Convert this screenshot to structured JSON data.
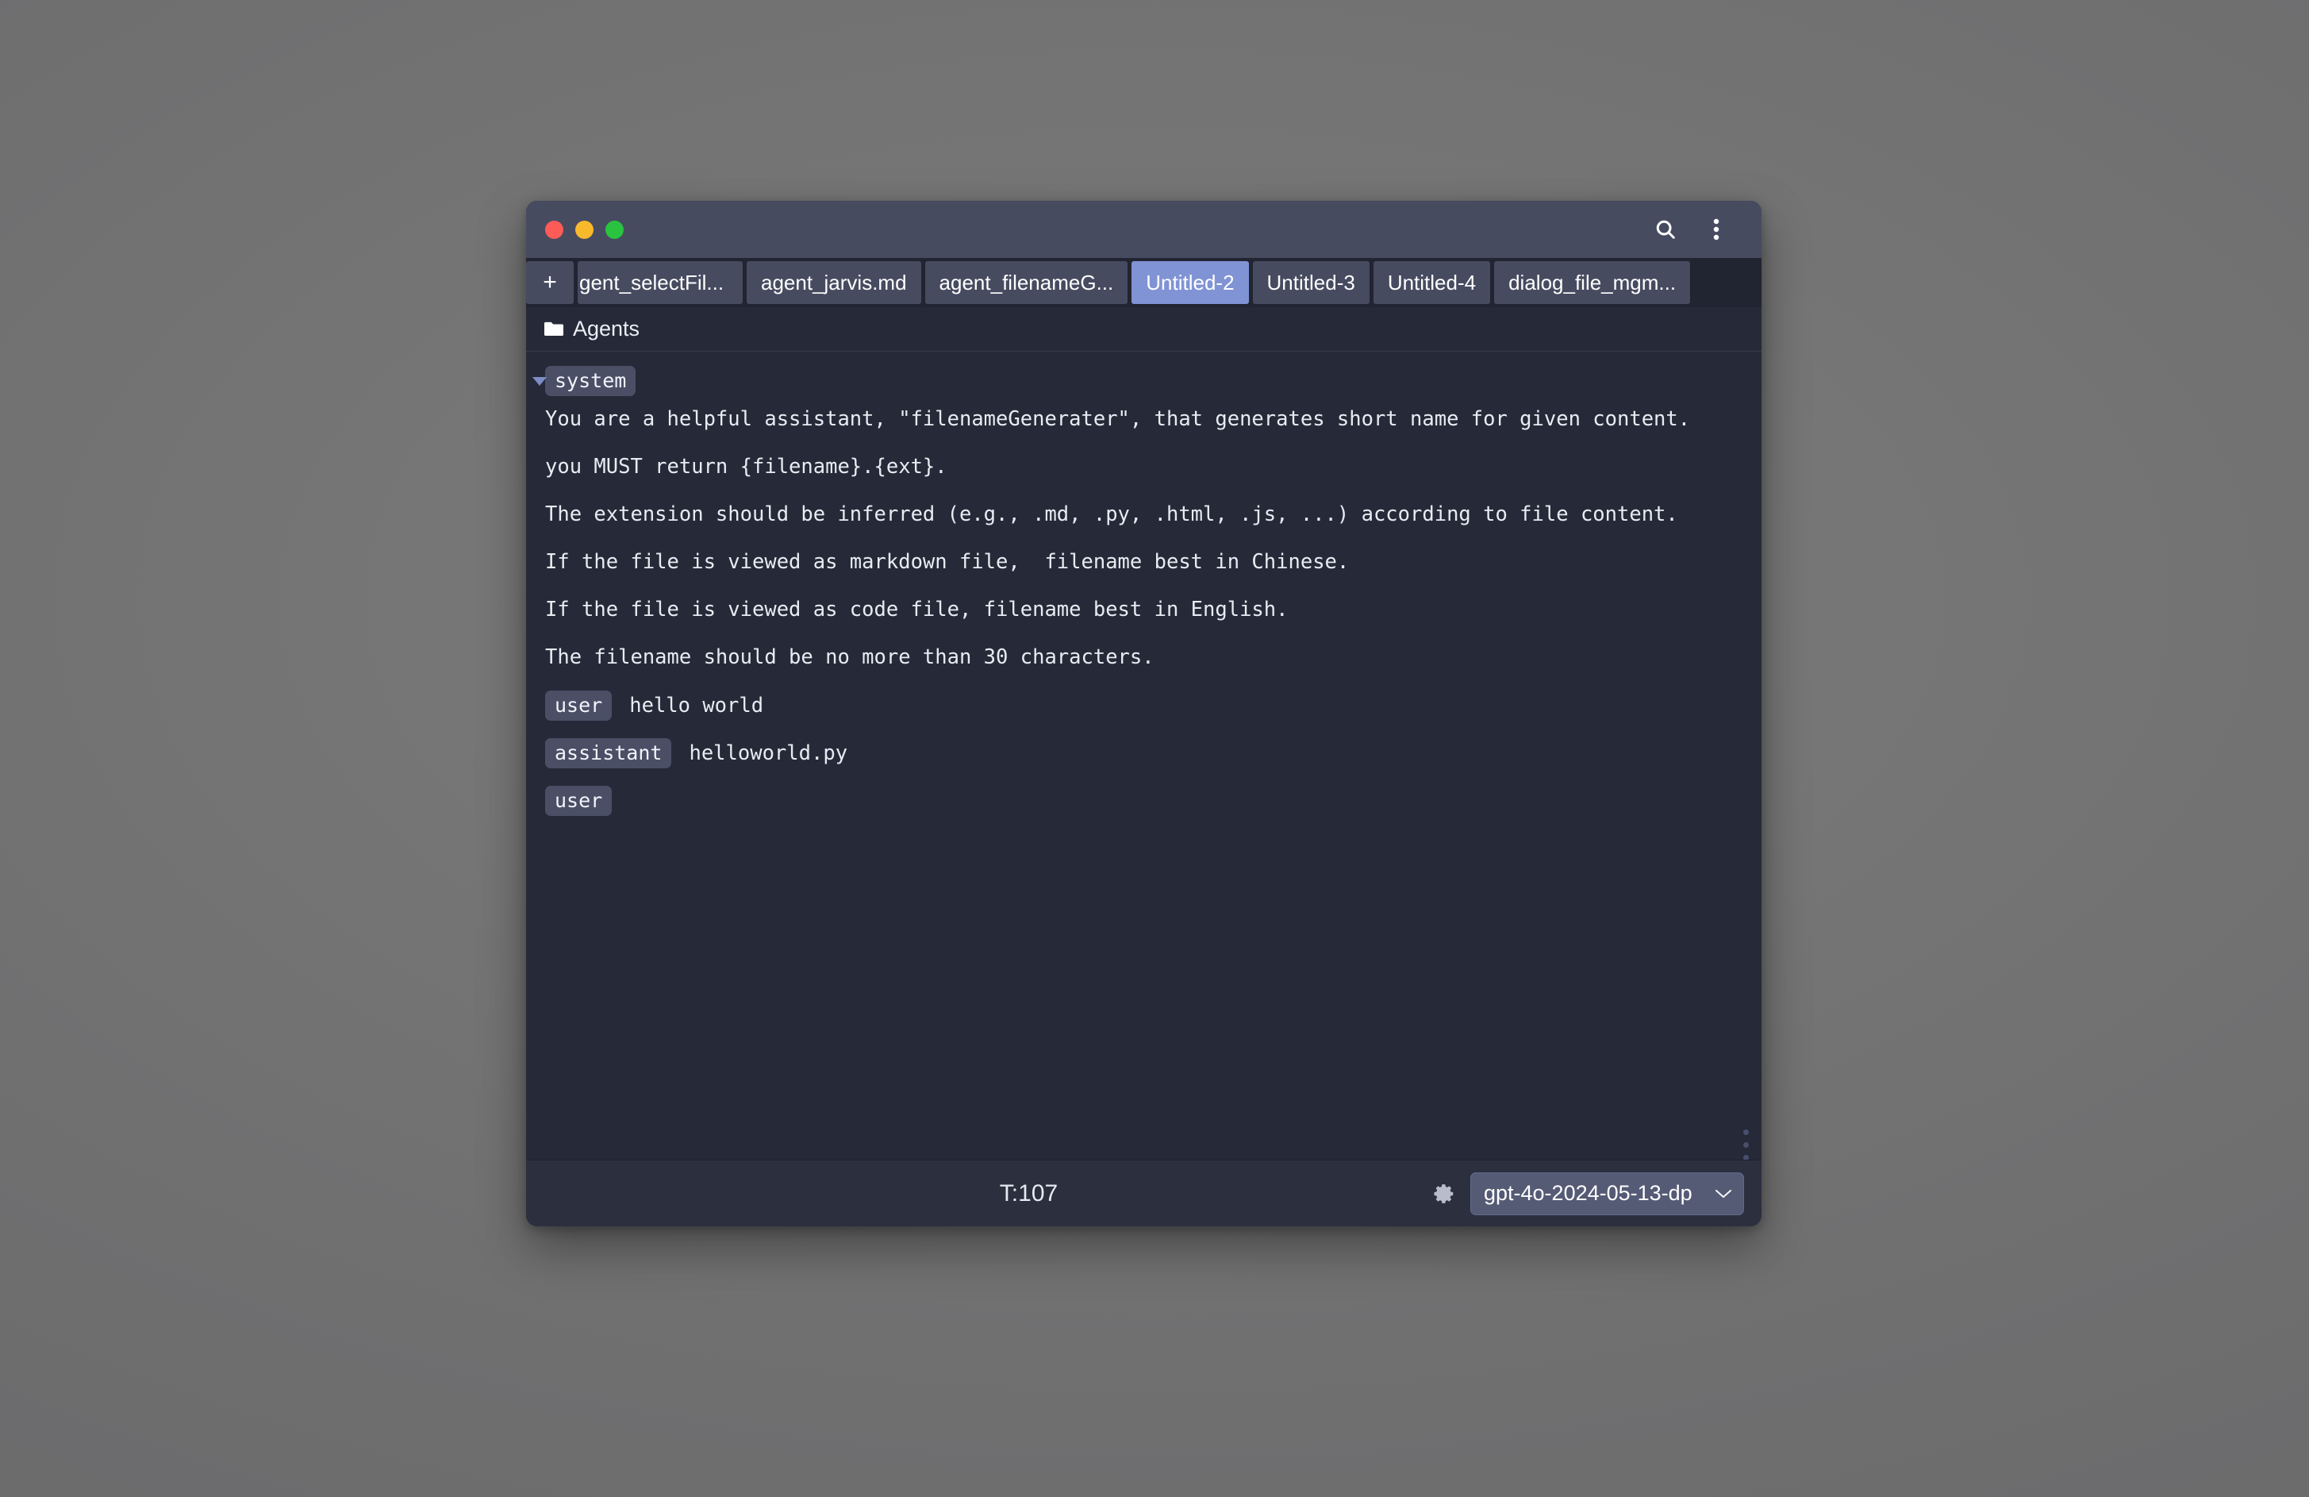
{
  "window": {
    "traffic_lights": [
      {
        "name": "close",
        "color": "#fc5b57"
      },
      {
        "name": "minimize",
        "color": "#f8b92c"
      },
      {
        "name": "maximize",
        "color": "#29c33f"
      }
    ],
    "title_actions": [
      {
        "name": "search-icon",
        "label": "Search"
      },
      {
        "name": "more-menu-icon",
        "label": "More options"
      }
    ]
  },
  "tabs": {
    "new_tab_label": "+",
    "items": [
      {
        "label": "gent_selectFil...",
        "active": false,
        "clipped": true
      },
      {
        "label": "agent_jarvis.md",
        "active": false,
        "clipped": false
      },
      {
        "label": "agent_filenameG...",
        "active": false,
        "clipped": false
      },
      {
        "label": "Untitled-2",
        "active": true,
        "clipped": false
      },
      {
        "label": "Untitled-3",
        "active": false,
        "clipped": false
      },
      {
        "label": "Untitled-4",
        "active": false,
        "clipped": false
      },
      {
        "label": "dialog_file_mgm...",
        "active": false,
        "clipped": false
      }
    ]
  },
  "breadcrumb": {
    "icon": "folder-icon",
    "label": "Agents"
  },
  "editor": {
    "system_role_label": "system",
    "system_lines": [
      "You are a helpful assistant, \"filenameGenerater\", that generates short name for given content.",
      "",
      "you MUST return {filename}.{ext}.",
      "",
      "The extension should be inferred (e.g., .md, .py, .html, .js, ...) according to file content.",
      "",
      "If the file is viewed as markdown file,  filename best in Chinese.",
      "",
      "If the file is viewed as code file, filename best in English.",
      "",
      "The filename should be no more than 30 characters."
    ],
    "messages": [
      {
        "role": "user",
        "text": "hello world"
      },
      {
        "role": "assistant",
        "text": "helloworld.py"
      },
      {
        "role": "user",
        "text": ""
      }
    ]
  },
  "status_bar": {
    "token_count": "T:107",
    "settings_icon": "gear-icon",
    "model_selected": "gpt-4o-2024-05-13-dp",
    "dropdown_icon": "chevron-down-icon"
  },
  "colors": {
    "desktop": "#6f6f70",
    "title_bar": "#474b60",
    "tab_bar": "#212431",
    "tab_inactive": "#474b60",
    "tab_active": "#8093d4",
    "content_bg": "#262a38",
    "status_bg": "#2b2f3e",
    "badge_bg": "#4a4f66",
    "text": "#e9ebf2",
    "select_bg": "#555b75"
  }
}
